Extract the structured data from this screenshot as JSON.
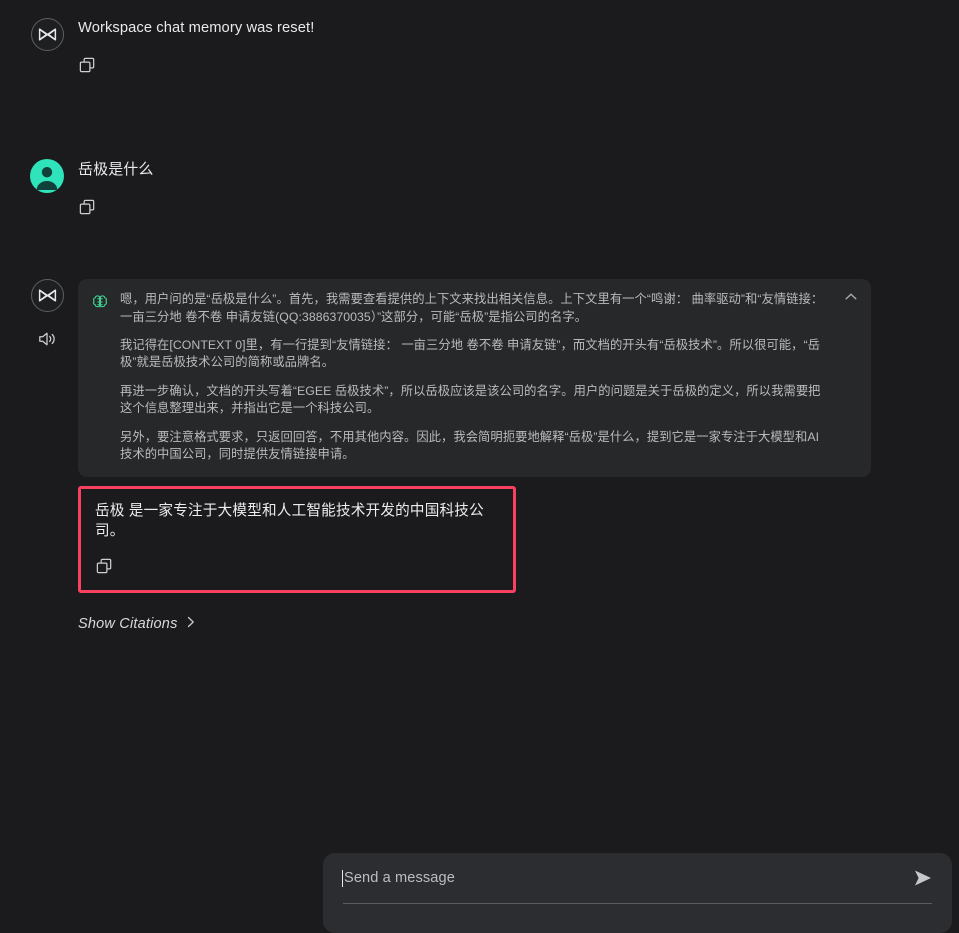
{
  "theme": {
    "page_bg": "#1b1b1d",
    "panel_bg": "#27282a",
    "composer_bg": "#2b2d30",
    "accent_user_avatar": "#2fe4bb",
    "accent_brain": "#3ecf8e",
    "highlight_border": "#f7415f",
    "text_primary": "#e9e9ec",
    "text_secondary": "#b9bbbe"
  },
  "messages": [
    {
      "role": "system",
      "avatar": "bot-logo-icon",
      "text": "Workspace chat memory was reset!",
      "copy_label": "copy-icon"
    },
    {
      "role": "user",
      "avatar": "user-avatar-icon",
      "text": "岳极是什么",
      "copy_label": "copy-icon"
    }
  ],
  "assistant": {
    "avatar": "bot-logo-icon",
    "speaker_icon": "speaker-icon",
    "thinking": {
      "icon": "brain-icon",
      "collapse_icon": "chevron-up-icon",
      "paragraphs": [
        "嗯，用户问的是“岳极是什么”。首先，我需要查看提供的上下文来找出相关信息。上下文里有一个“鸣谢：  曲率驱动”和“友情链接：  一亩三分地  卷不卷  申请友链(QQ:3886370035）”这部分，可能“岳极”是指公司的名字。",
        "我记得在[CONTEXT 0]里，有一行提到“友情链接：  一亩三分地  卷不卷  申请友链”，而文档的开头有“岳极技术”。所以很可能，“岳极”就是岳极技术公司的简称或品牌名。",
        "再进一步确认，文档的开头写着“EGEE  岳极技术”，所以岳极应该是该公司的名字。用户的问题是关于岳极的定义，所以我需要把这个信息整理出来，并指出它是一个科技公司。",
        "另外，要注意格式要求，只返回回答，不用其他内容。因此，我会简明扼要地解释“岳极”是什么，提到它是一家专注于大模型和AI技术的中国公司，同时提供友情链接申请。"
      ]
    },
    "answer": {
      "text": "岳极 是一家专注于大模型和人工智能技术开发的中国科技公司。",
      "copy_label": "copy-icon",
      "highlighted": true
    },
    "citations": {
      "label": "Show Citations",
      "chevron": "chevron-right-icon"
    }
  },
  "composer": {
    "placeholder": "Send a message",
    "value": "",
    "send_icon": "send-icon"
  }
}
